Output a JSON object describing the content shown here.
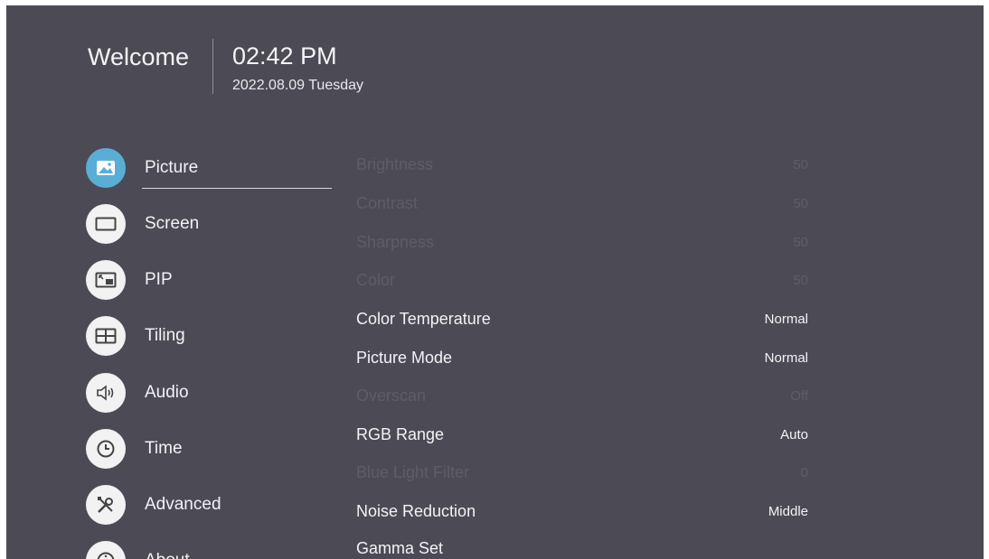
{
  "header": {
    "welcome": "Welcome",
    "time": "02:42 PM",
    "date": "2022.08.09 Tuesday"
  },
  "nav": {
    "items": [
      {
        "label": "Picture",
        "icon": "picture-icon",
        "active": true
      },
      {
        "label": "Screen",
        "icon": "screen-icon"
      },
      {
        "label": "PIP",
        "icon": "pip-icon"
      },
      {
        "label": "Tiling",
        "icon": "tiling-icon"
      },
      {
        "label": "Audio",
        "icon": "audio-icon"
      },
      {
        "label": "Time",
        "icon": "clock-icon"
      },
      {
        "label": "Advanced",
        "icon": "tools-icon"
      },
      {
        "label": "About",
        "icon": "info-icon"
      }
    ]
  },
  "settings": [
    {
      "label": "Brightness",
      "value": "50",
      "enabled": false
    },
    {
      "label": "Contrast",
      "value": "50",
      "enabled": false
    },
    {
      "label": "Sharpness",
      "value": "50",
      "enabled": false
    },
    {
      "label": "Color",
      "value": "50",
      "enabled": false
    },
    {
      "label": "Color Temperature",
      "value": "Normal",
      "enabled": true
    },
    {
      "label": "Picture Mode",
      "value": "Normal",
      "enabled": true
    },
    {
      "label": "Overscan",
      "value": "Off",
      "enabled": false
    },
    {
      "label": "RGB Range",
      "value": "Auto",
      "enabled": true
    },
    {
      "label": "Blue Light Filter",
      "value": "0",
      "enabled": false
    },
    {
      "label": "Noise Reduction",
      "value": "Middle",
      "enabled": true
    },
    {
      "label": "Gamma Set",
      "value": "",
      "enabled": true
    }
  ],
  "colors": {
    "background": "#4c4b55",
    "active_icon": "#5aaed6",
    "text": "#f3f3f5",
    "disabled_text": "#5e5d67"
  }
}
